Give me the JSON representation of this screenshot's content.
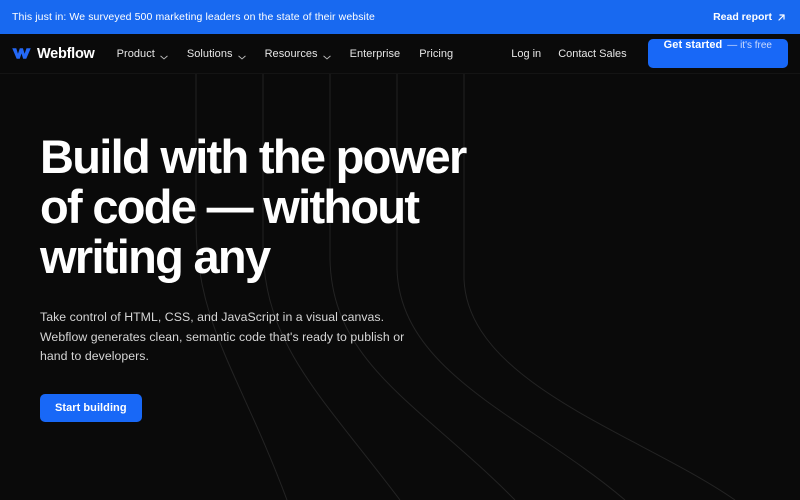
{
  "banner": {
    "text": "This just in: We surveyed 500 marketing leaders on the state of their website",
    "link_label": "Read report",
    "link_icon": "arrow-up-right-icon",
    "bg_color": "#1869f0",
    "text_color": "#ffffff"
  },
  "nav": {
    "brand": {
      "name": "Webflow",
      "logo_icon": "webflow-logo-icon",
      "logo_color": "#2468f6"
    },
    "items": [
      {
        "label": "Product",
        "has_dropdown": true,
        "icon": "chevron-down-icon"
      },
      {
        "label": "Solutions",
        "has_dropdown": true,
        "icon": "chevron-down-icon"
      },
      {
        "label": "Resources",
        "has_dropdown": true,
        "icon": "chevron-down-icon"
      },
      {
        "label": "Enterprise",
        "has_dropdown": false,
        "icon": ""
      },
      {
        "label": "Pricing",
        "has_dropdown": false,
        "icon": ""
      }
    ],
    "login_label": "Log in",
    "contact_label": "Contact Sales",
    "cta": {
      "label": "Get started",
      "suffix": "— it's free",
      "bg_color": "#1868f7"
    }
  },
  "hero": {
    "headline": "Build with the power of code — without writing any",
    "subcopy": "Take control of HTML, CSS, and JavaScript in a visual canvas. Webflow generates clean, semantic code that's ready to publish or hand to developers.",
    "cta_label": "Start building",
    "cta_color": "#1868f7",
    "bg_color": "#0a0a0a",
    "line_color": "rgba(255,255,255,0.10)"
  }
}
